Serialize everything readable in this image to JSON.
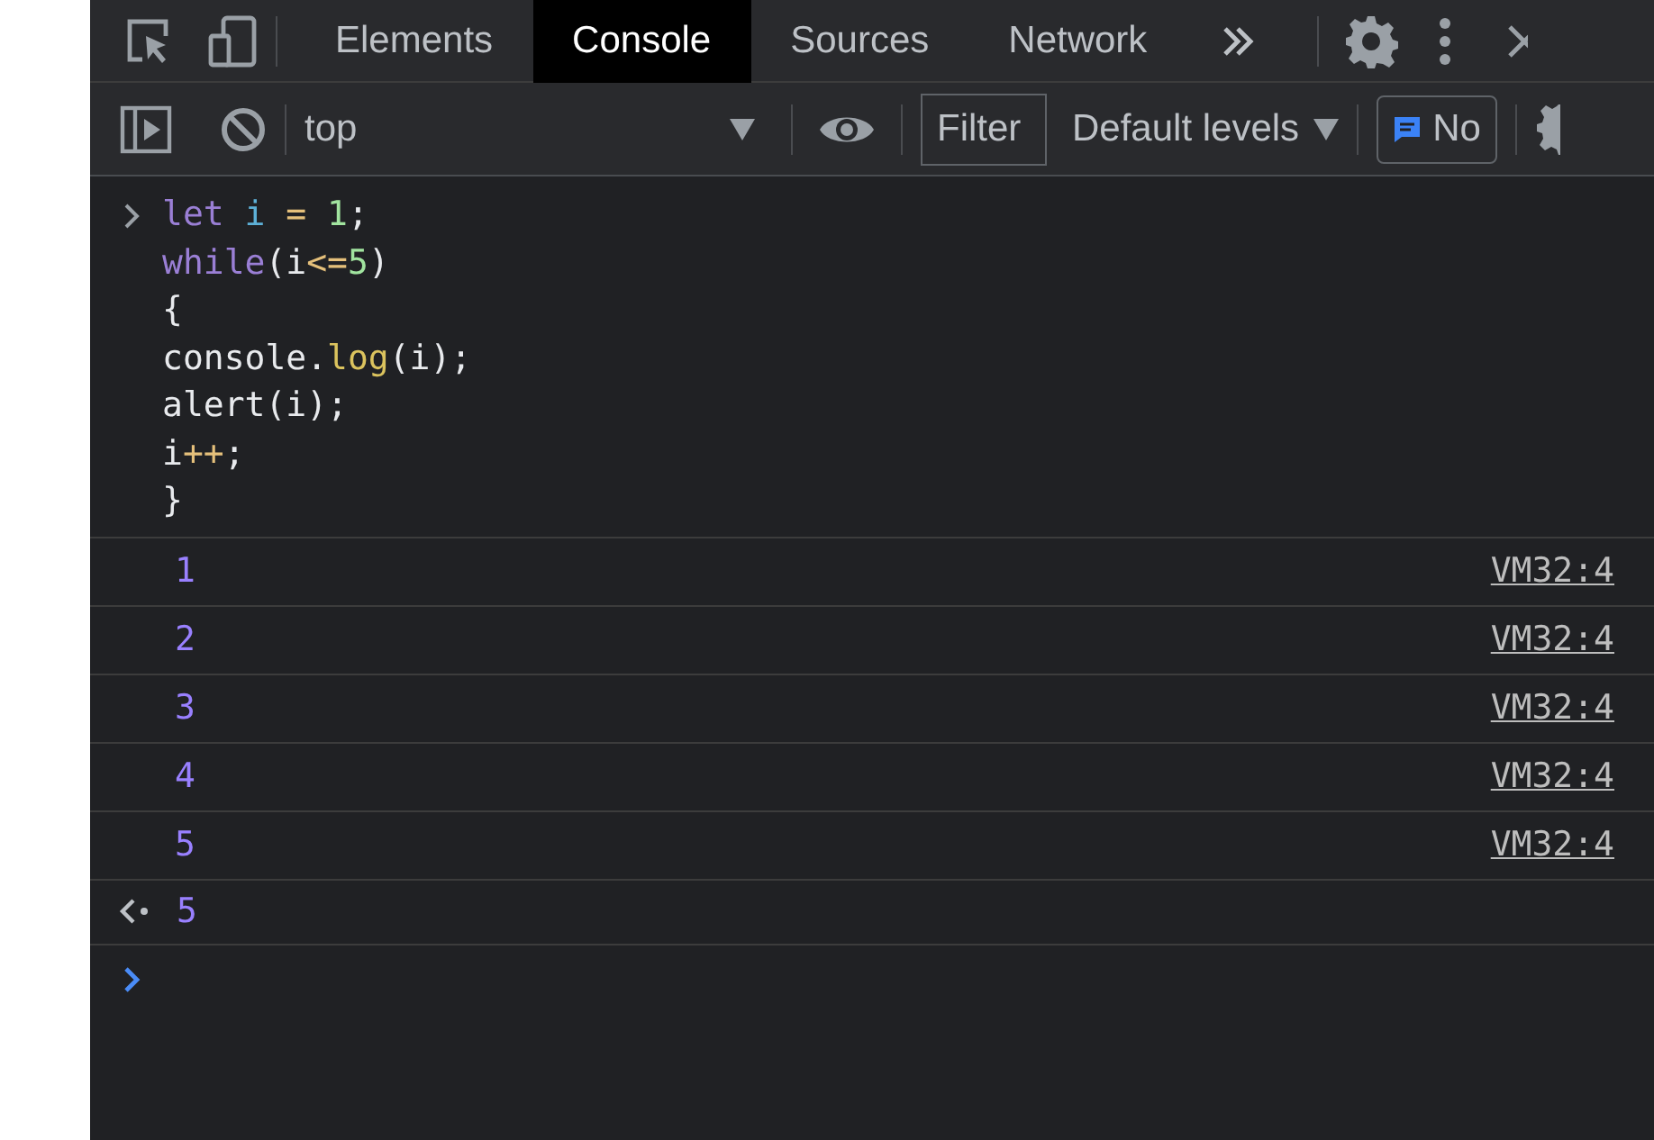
{
  "main_toolbar": {
    "tabs": [
      {
        "label": "Elements",
        "selected": false
      },
      {
        "label": "Console",
        "selected": true
      },
      {
        "label": "Sources",
        "selected": false
      },
      {
        "label": "Network",
        "selected": false
      }
    ]
  },
  "console_toolbar": {
    "context": "top",
    "filter": {
      "placeholder": "Filter"
    },
    "levels": "Default levels",
    "issues": "No"
  },
  "input": {
    "lines": [
      [
        {
          "kind": "keyword",
          "text": "let"
        },
        {
          "kind": "variable",
          "text": " i"
        },
        {
          "kind": "operator",
          "text": " ="
        },
        {
          "kind": "number",
          "text": " 1"
        },
        {
          "kind": "plain",
          "text": ";"
        }
      ],
      [
        {
          "kind": "keyword",
          "text": "while"
        },
        {
          "kind": "plain",
          "text": "(i"
        },
        {
          "kind": "operator",
          "text": "<="
        },
        {
          "kind": "number",
          "text": "5"
        },
        {
          "kind": "plain",
          "text": ")"
        }
      ],
      [
        {
          "kind": "plain",
          "text": "{"
        }
      ],
      [
        {
          "kind": "plain",
          "text": "console."
        },
        {
          "kind": "method",
          "text": "log"
        },
        {
          "kind": "plain",
          "text": "(i);"
        }
      ],
      [
        {
          "kind": "plain",
          "text": "alert(i);"
        }
      ],
      [
        {
          "kind": "plain",
          "text": "i"
        },
        {
          "kind": "operator",
          "text": "++"
        },
        {
          "kind": "plain",
          "text": ";"
        }
      ],
      [
        {
          "kind": "plain",
          "text": "}"
        }
      ]
    ]
  },
  "logs": [
    {
      "value": "1",
      "source": "VM32:4"
    },
    {
      "value": "2",
      "source": "VM32:4"
    },
    {
      "value": "3",
      "source": "VM32:4"
    },
    {
      "value": "4",
      "source": "VM32:4"
    },
    {
      "value": "5",
      "source": "VM32:4"
    }
  ],
  "result": {
    "value": "5"
  }
}
